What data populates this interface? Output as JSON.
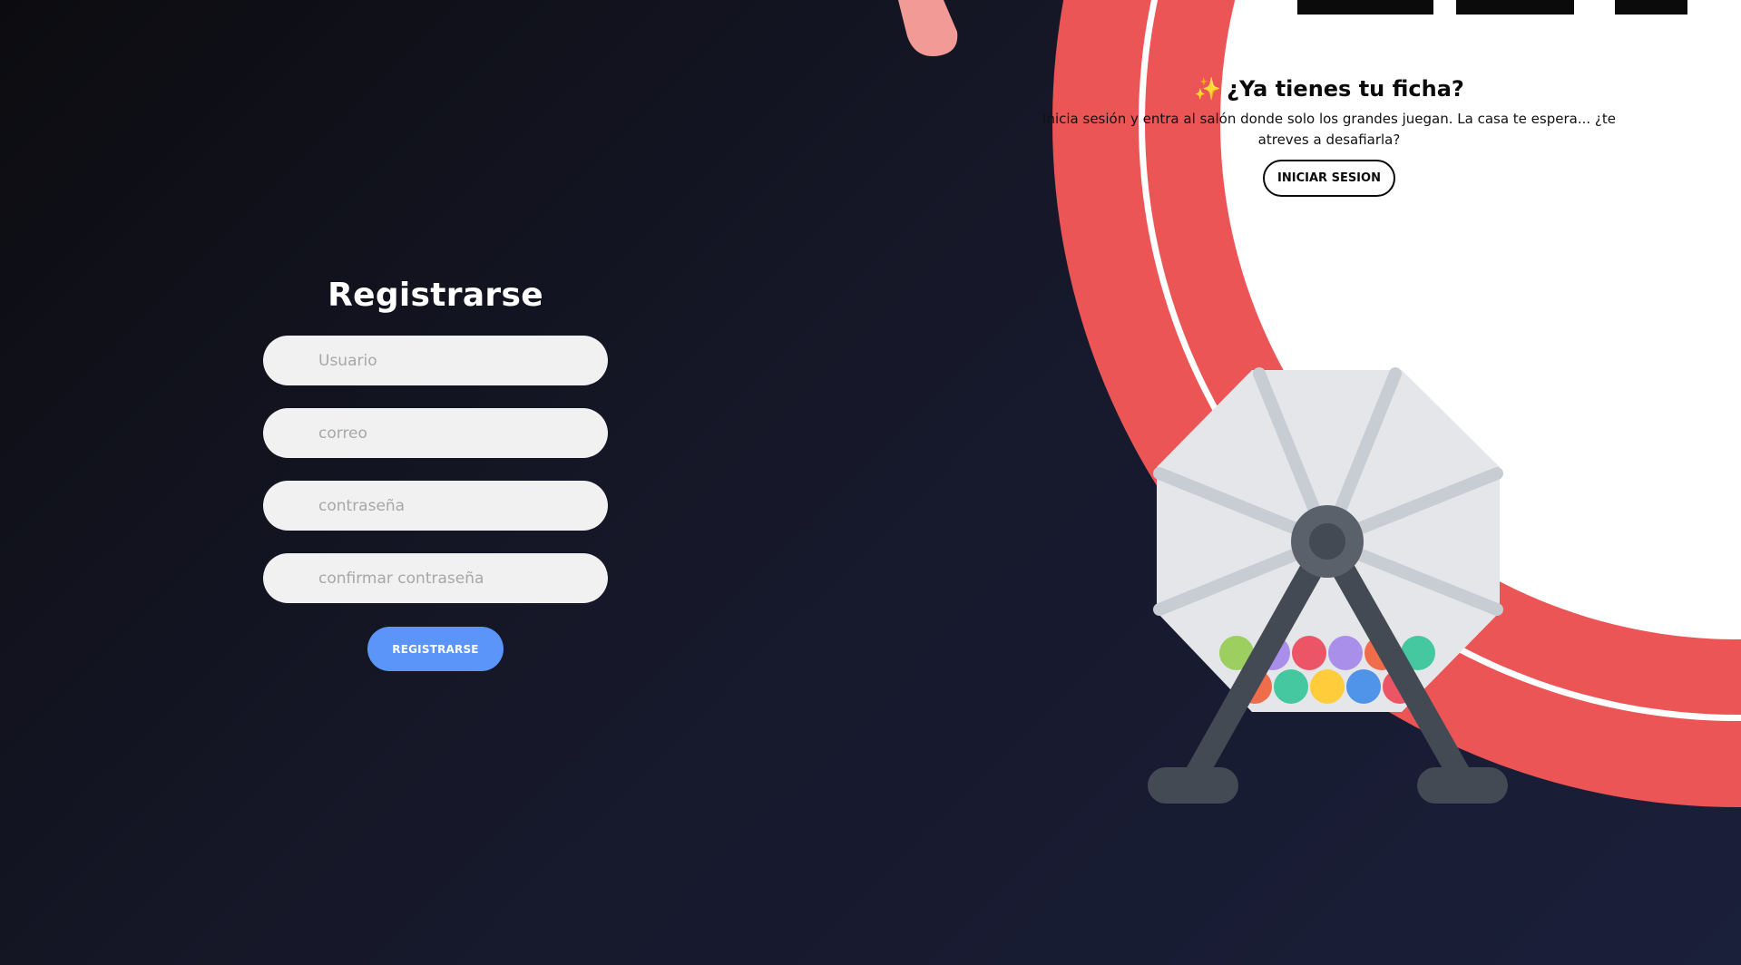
{
  "register": {
    "title": "Registrarse",
    "username_placeholder": "Usuario",
    "email_placeholder": "correo",
    "password_placeholder": "contraseña",
    "confirm_password_placeholder": "confirmar contraseña",
    "submit_label": "REGISTRARSE"
  },
  "login_prompt": {
    "sparkle": "✨",
    "title": "¿Ya tienes tu ficha?",
    "text": "Inicia sesión y entra al salón donde solo los grandes juegan. La casa te espera... ¿te atreves a desafiarla?",
    "button_label": "INICIAR SESION"
  },
  "colors": {
    "background_start": "#0c0c10",
    "background_end": "#1a1f3a",
    "accent_red": "#ec5555",
    "primary_button": "#5b95f9",
    "input_background": "#f1f1f1"
  },
  "illustration": {
    "icon": "lottery-wheel-icon"
  }
}
